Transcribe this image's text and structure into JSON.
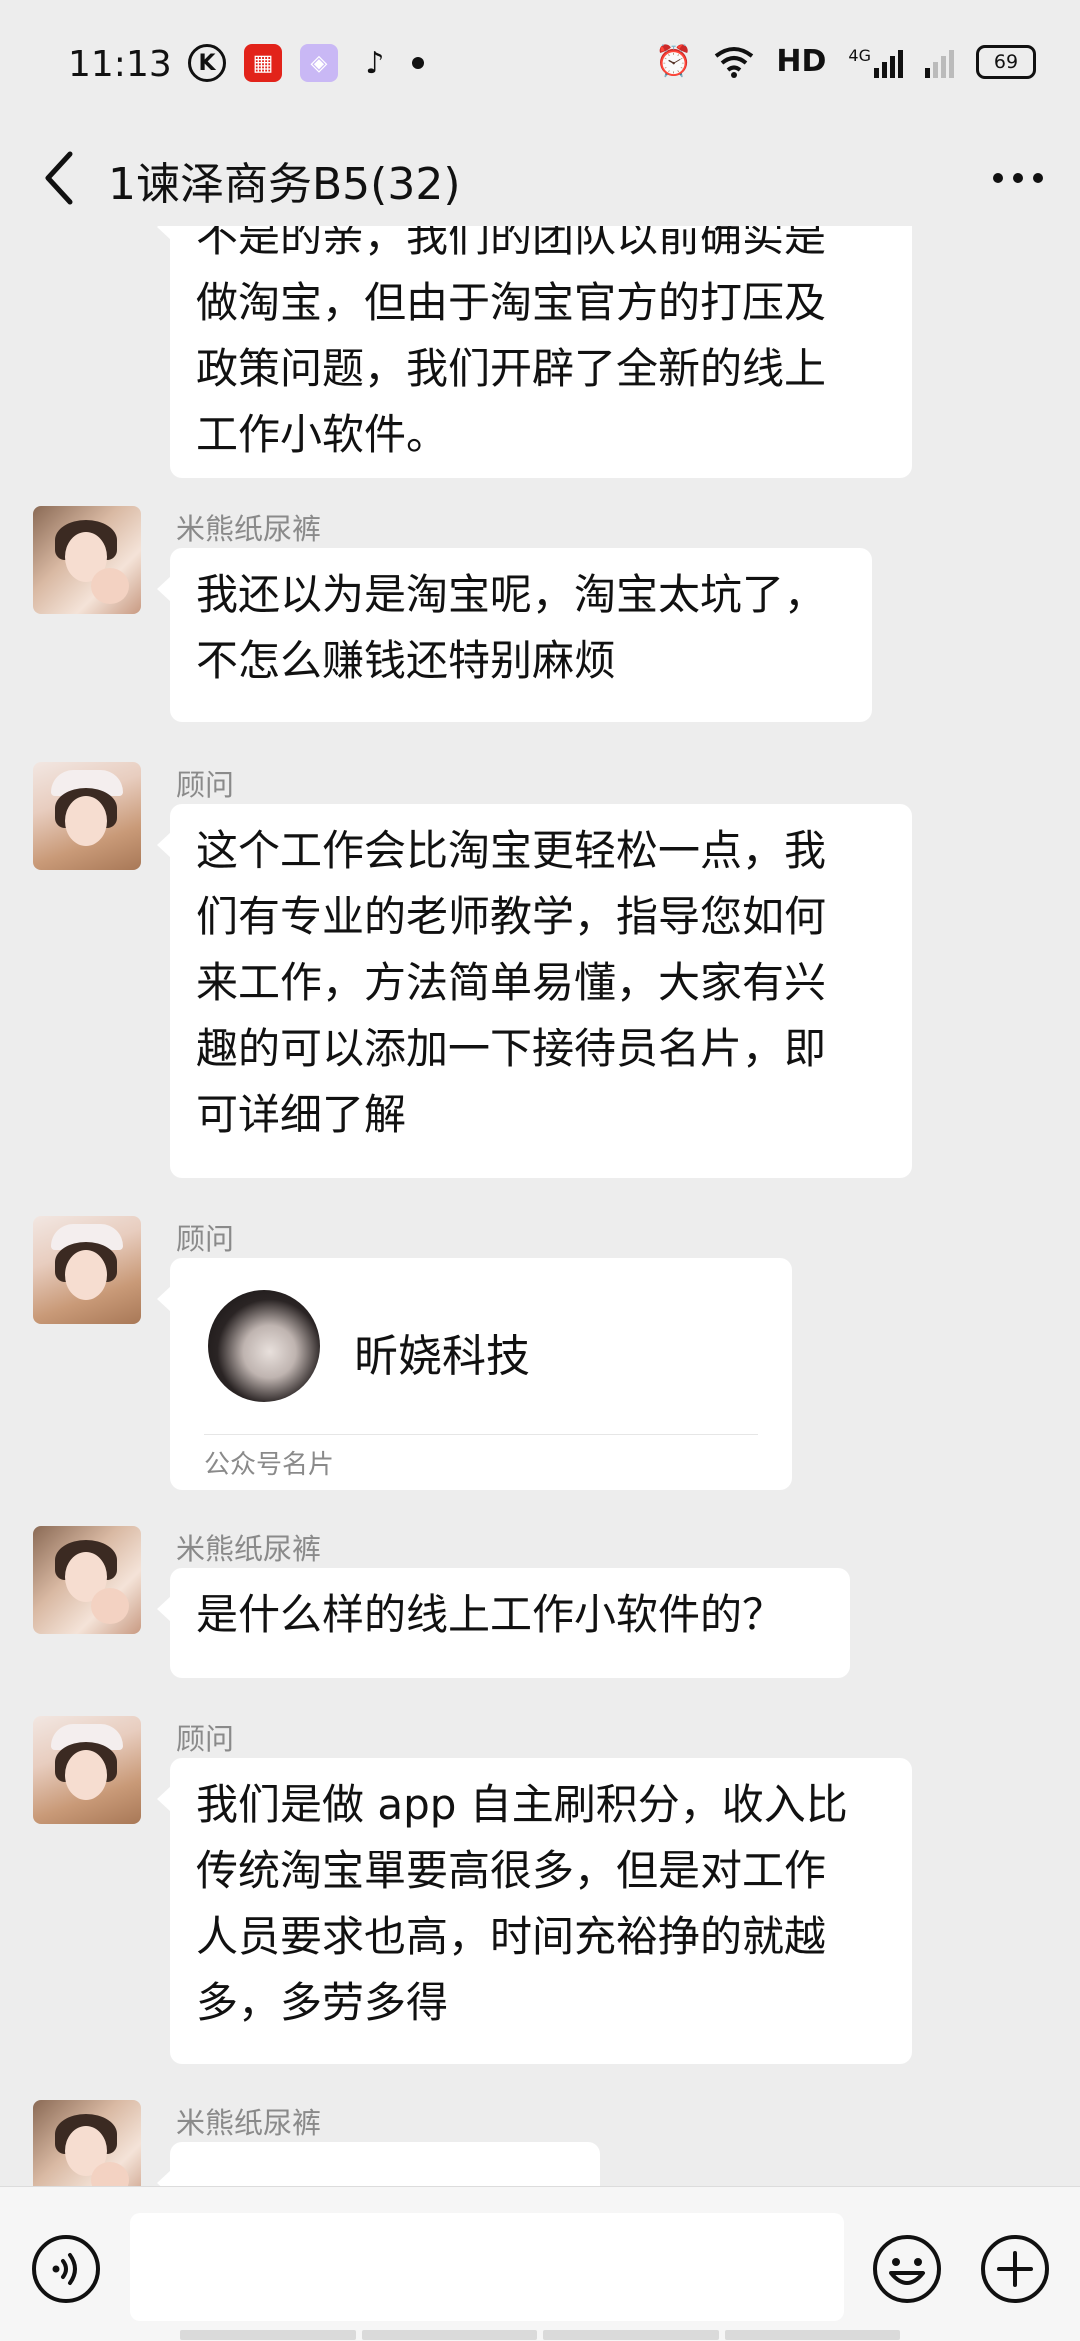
{
  "status_bar": {
    "time": "11:13",
    "left_icons": [
      "k-app-icon",
      "shopping-app-icon",
      "bag-app-icon",
      "tiktok-icon",
      "dot-icon"
    ],
    "network": "HD",
    "signal_label": "4G",
    "battery": "69"
  },
  "header": {
    "title": "1谏泽商务B5(32)"
  },
  "messages": [
    {
      "type": "text",
      "sender": "",
      "lines": [
        "不是的亲，我们的团队以前确实是",
        "做淘宝，但由于淘宝官方的打压及",
        "政策问题，我们开辟了全新的线上",
        "工作小软件。"
      ]
    },
    {
      "type": "text",
      "sender": "米熊纸尿裤",
      "lines": [
        "我还以为是淘宝呢，淘宝太坑了，",
        "不怎么赚钱还特别麻烦"
      ]
    },
    {
      "type": "text",
      "sender": "顾问",
      "lines": [
        "这个工作会比淘宝更轻松一点，我",
        "们有专业的老师教学，指导您如何",
        "来工作，方法简单易懂，大家有兴",
        "趣的可以添加一下接待员名片，即",
        "可详细了解"
      ]
    },
    {
      "type": "card",
      "sender": "顾问",
      "card_name": "昕娆科技",
      "card_type": "公众号名片"
    },
    {
      "type": "text",
      "sender": "米熊纸尿裤",
      "lines": [
        "是什么样的线上工作小软件的？"
      ]
    },
    {
      "type": "text",
      "sender": "顾问",
      "lines": [
        "我们是做 app 自主刷积分，收入比",
        "传统淘宝單要高很多，但是对工作",
        "人员要求也高，时间充裕挣的就越",
        "多，多劳多得"
      ]
    },
    {
      "type": "text",
      "sender": "米熊纸尿裤",
      "lines": [
        ""
      ]
    }
  ],
  "input_bar": {
    "placeholder": ""
  },
  "colors": {
    "background": "#ededed",
    "bubble": "#ffffff",
    "sender_name": "#8a8a8a"
  }
}
